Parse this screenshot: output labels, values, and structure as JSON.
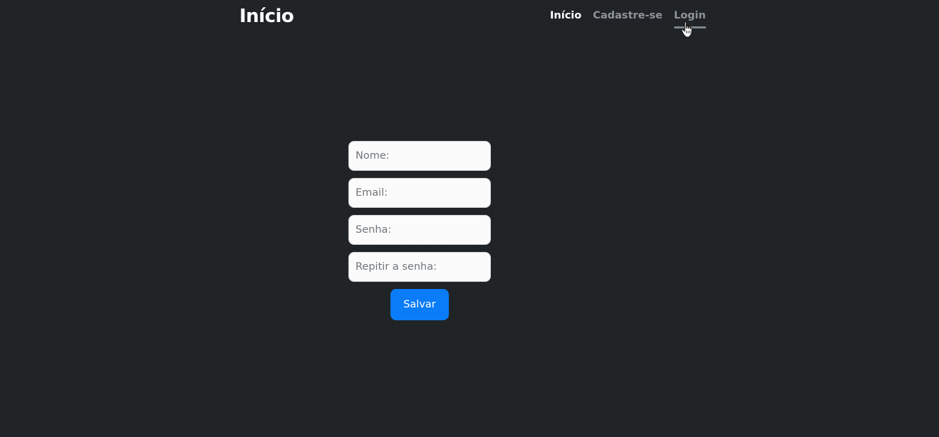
{
  "header": {
    "brand": "Início",
    "nav": [
      {
        "label": "Início"
      },
      {
        "label": "Cadastre-se"
      },
      {
        "label": "Login"
      }
    ]
  },
  "form": {
    "name_placeholder": "Nome:",
    "email_placeholder": "Email:",
    "password_placeholder": "Senha:",
    "repeat_password_placeholder": "Repitir a senha:",
    "save_label": "Salvar"
  },
  "colors": {
    "background": "#1f2326",
    "primary_button": "#0b7cf7",
    "nav_inactive": "#8e9399",
    "nav_active": "#ffffff"
  },
  "icons": {
    "cursor": "hand-pointer-icon"
  }
}
